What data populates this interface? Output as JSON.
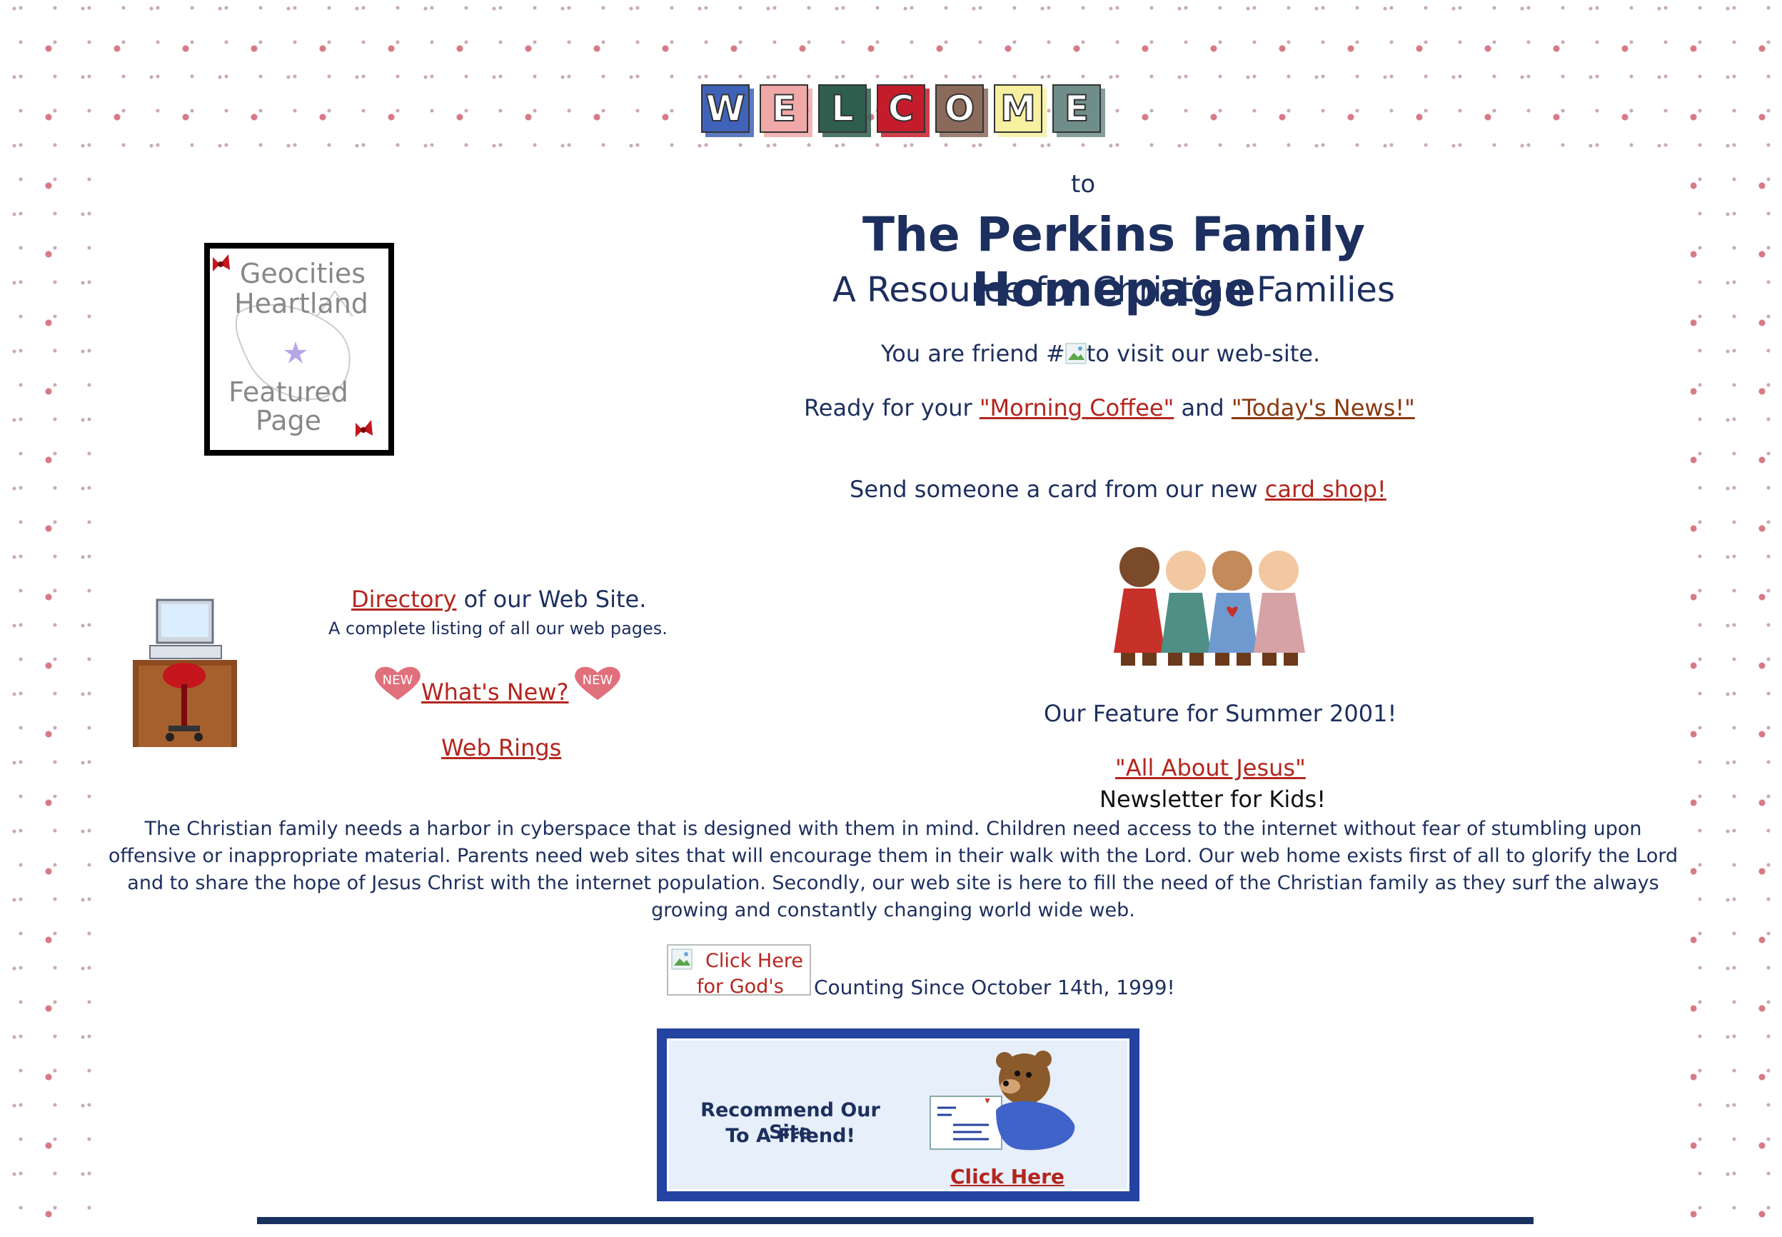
{
  "welcome": {
    "letters": [
      "W",
      "E",
      "L",
      "C",
      "O",
      "M",
      "E"
    ],
    "tile_colors": [
      "#3f63b8",
      "#f0a8a8",
      "#2f5e4e",
      "#c51c2c",
      "#8a6a5a",
      "#f6f0a0",
      "#6f8e8a"
    ],
    "to": "to"
  },
  "header": {
    "title": "The Perkins Family Homepage",
    "subtitle": "A Resource for Christian Families"
  },
  "counter_line": {
    "prefix": "You are friend #",
    "suffix": "to visit our web-site."
  },
  "coffee_line": {
    "prefix": "Ready for your ",
    "link1": "\"Morning Coffee\"",
    "middle": " and ",
    "link2": "\"Today's News!\""
  },
  "card_line": {
    "prefix": "Send someone a card from our new ",
    "link": "card shop!"
  },
  "badge": {
    "line1": "Geocities",
    "line2": "Heartland",
    "line3": "Featured",
    "line4": "Page"
  },
  "directory": {
    "link": "Directory",
    "suffix": " of our Web Site.",
    "caption": "A complete listing of all our web pages.",
    "whats_new": "What's New?",
    "new_badge": "NEW",
    "web_rings": "Web Rings"
  },
  "feature": {
    "heading": "Our Feature for Summer 2001!",
    "link": "\"All About Jesus\"",
    "caption": "Newsletter for Kids!"
  },
  "mission": "The Christian family needs a harbor in cyberspace that is designed with them in mind. Children need access to the internet without fear of stumbling upon offensive or inappropriate material. Parents need web sites that will encourage them in their walk with the Lord. Our web home exists first of all to glorify the Lord and to share the hope of Jesus Christ with the internet population. Secondly, our web site is here to fill the need of the Christian family as they surf the always growing and constantly changing world wide web.",
  "counting": {
    "img_alt_line1": "Click Here",
    "img_alt_line2": "for God's",
    "text": "Counting Since October 14th, 1999!"
  },
  "recommend": {
    "line1": "Recommend Our Site",
    "line2": "To A Friend!",
    "link": "Click Here"
  },
  "colors": {
    "text": "#1c2f5e",
    "link": "#b3261e",
    "link_alt": "#8a3a10",
    "frame": "#2443a0"
  }
}
